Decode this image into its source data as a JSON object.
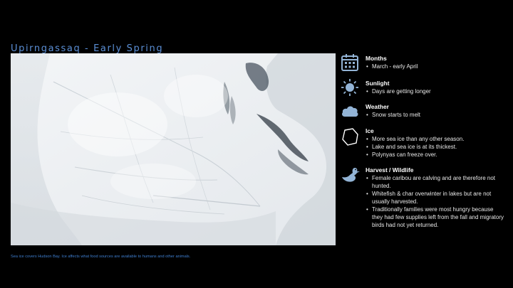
{
  "title": "Upirngassaq - Early Spring",
  "caption": "Sea ice covers Hudson Bay. Ice affects what food sources are available to humans and other animals.",
  "colors": {
    "title": "#5b8fd6",
    "caption": "#3f7fd0",
    "icon": "#93b4d6",
    "background": "#000000"
  },
  "photo": {
    "alt": "Sea ice covering Hudson Bay"
  },
  "sections": [
    {
      "icon": "calendar-icon",
      "heading": "Months",
      "items": [
        "March - early April"
      ]
    },
    {
      "icon": "sun-icon",
      "heading": "Sunlight",
      "items": [
        "Days are getting longer"
      ]
    },
    {
      "icon": "cloud-icon",
      "heading": "Weather",
      "items": [
        "Snow starts to melt"
      ]
    },
    {
      "icon": "ice-icon",
      "heading": "Ice",
      "items": [
        "More sea ice than any other season.",
        "Lake and sea ice is at its thickest.",
        "Polynyas can freeze over."
      ]
    },
    {
      "icon": "duck-icon",
      "heading": "Harvest / Wildlife",
      "items": [
        "Female caribou are calving and are therefore not hunted.",
        "Whitefish & char overwinter in lakes but are not usually harvested.",
        "Traditionally families were most hungry because they had few supplies left from the fall and migratory birds had not yet returned."
      ]
    }
  ]
}
